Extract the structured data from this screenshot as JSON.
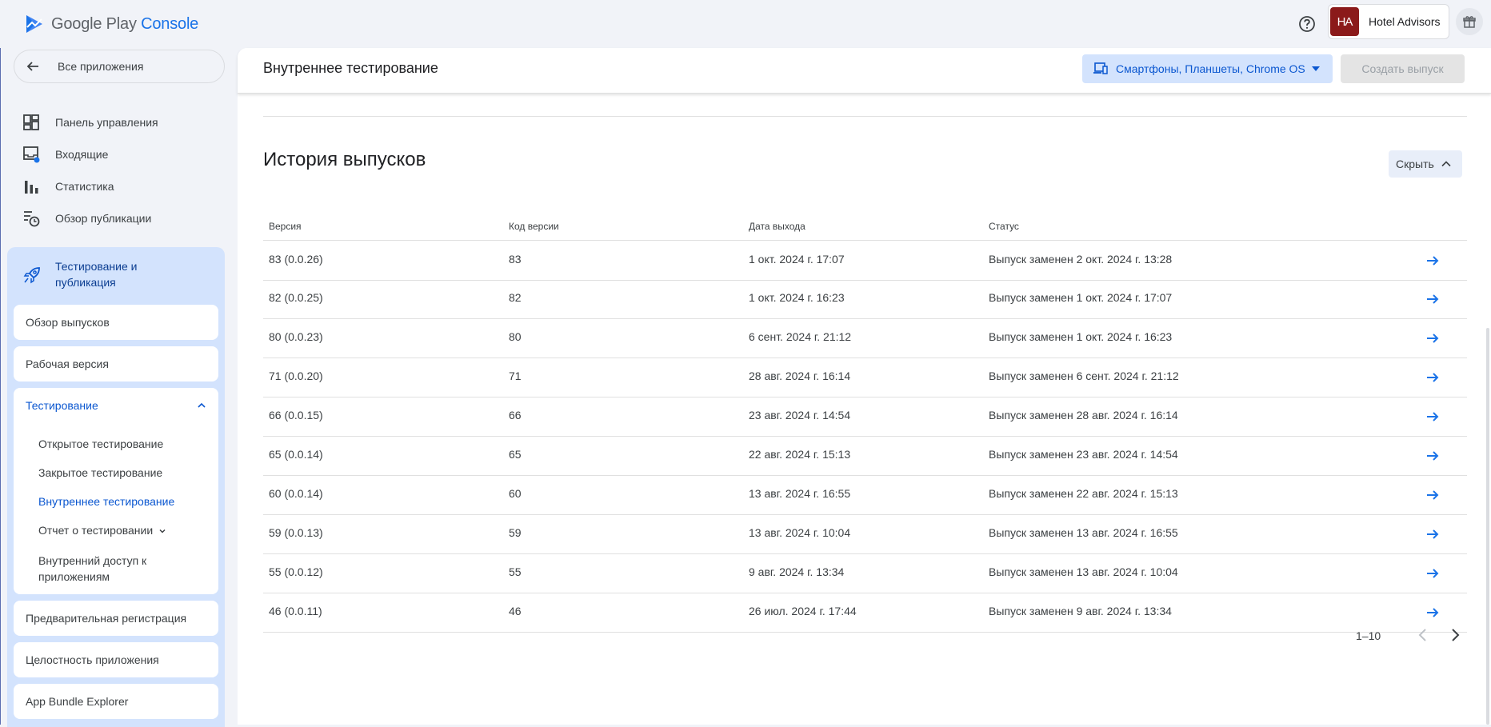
{
  "brand": {
    "name_part1": "Google Play ",
    "name_part2": "Console"
  },
  "account": {
    "initials": "HA",
    "name": "Hotel Advisors"
  },
  "sidebar": {
    "back_label": "Все приложения",
    "items": [
      {
        "label": "Панель управления",
        "icon": "dashboard-icon"
      },
      {
        "label": "Входящие",
        "icon": "inbox-icon"
      },
      {
        "label": "Статистика",
        "icon": "bar-chart-icon"
      },
      {
        "label": "Обзор публикации",
        "icon": "publishing-overview-icon"
      }
    ],
    "section": {
      "label": "Тестирование и публикация",
      "cards": {
        "releases_overview": "Обзор выпусков",
        "production": "Рабочая версия",
        "testing": "Тестирование",
        "pre_registration": "Предварительная регистрация",
        "app_integrity": "Целостность приложения",
        "bundle_explorer": "App Bundle Explorer"
      },
      "testing_sub": {
        "open": "Открытое тестирование",
        "closed": "Закрытое тестирование",
        "internal": "Внутреннее тестирование",
        "report": "Отчет о тестировании",
        "access_line1": "Внутренний доступ к",
        "access_line2": "приложениям"
      }
    }
  },
  "header": {
    "title": "Внутреннее тестирование",
    "devices_label": "Смартфоны, Планшеты, Chrome OS",
    "create_label": "Создать выпуск"
  },
  "history": {
    "title": "История выпусков",
    "hide_label": "Скрыть",
    "columns": {
      "version": "Версия",
      "code": "Код версии",
      "date": "Дата выхода",
      "status": "Статус"
    },
    "rows": [
      {
        "version": "83 (0.0.26)",
        "code": "83",
        "date": "1 окт. 2024 г. 17:07",
        "status": "Выпуск заменен 2 окт. 2024 г. 13:28"
      },
      {
        "version": "82 (0.0.25)",
        "code": "82",
        "date": "1 окт. 2024 г. 16:23",
        "status": "Выпуск заменен 1 окт. 2024 г. 17:07"
      },
      {
        "version": "80 (0.0.23)",
        "code": "80",
        "date": "6 сент. 2024 г. 21:12",
        "status": "Выпуск заменен 1 окт. 2024 г. 16:23"
      },
      {
        "version": "71 (0.0.20)",
        "code": "71",
        "date": "28 авг. 2024 г. 16:14",
        "status": "Выпуск заменен 6 сент. 2024 г. 21:12"
      },
      {
        "version": "66 (0.0.15)",
        "code": "66",
        "date": "23 авг. 2024 г. 14:54",
        "status": "Выпуск заменен 28 авг. 2024 г. 16:14"
      },
      {
        "version": "65 (0.0.14)",
        "code": "65",
        "date": "22 авг. 2024 г. 15:13",
        "status": "Выпуск заменен 23 авг. 2024 г. 14:54"
      },
      {
        "version": "60 (0.0.14)",
        "code": "60",
        "date": "13 авг. 2024 г. 16:55",
        "status": "Выпуск заменен 22 авг. 2024 г. 15:13"
      },
      {
        "version": "59 (0.0.13)",
        "code": "59",
        "date": "13 авг. 2024 г. 10:04",
        "status": "Выпуск заменен 13 авг. 2024 г. 16:55"
      },
      {
        "version": "55 (0.0.12)",
        "code": "55",
        "date": "9 авг. 2024 г. 13:34",
        "status": "Выпуск заменен 13 авг. 2024 г. 10:04"
      },
      {
        "version": "46 (0.0.11)",
        "code": "46",
        "date": "26 июл. 2024 г. 17:44",
        "status": "Выпуск заменен 9 авг. 2024 г. 13:34"
      }
    ],
    "pagination": "1–10"
  },
  "colors": {
    "accent": "#0b57d0",
    "link_blue": "#1a73e8",
    "section_bg": "#d3e3fd",
    "avatar_bg": "#8b1a1a"
  }
}
